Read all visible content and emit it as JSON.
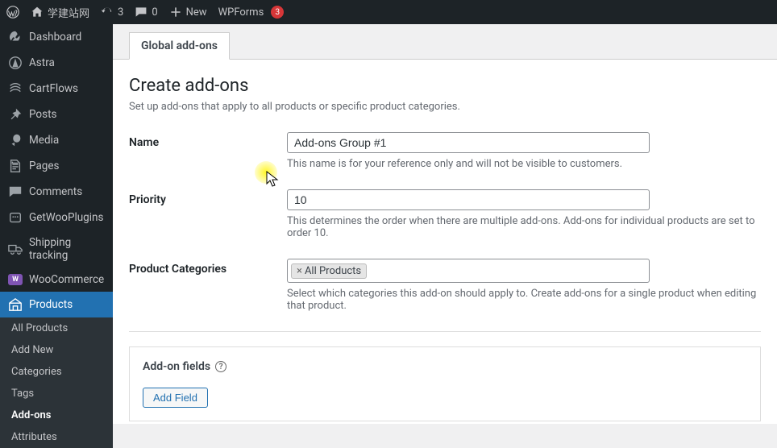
{
  "topbar": {
    "site_name": "学建站网",
    "updates_count": "3",
    "comments_count": "0",
    "new_label": "New",
    "wpforms_label": "WPForms",
    "wpforms_badge": "3"
  },
  "sidebar": {
    "items": [
      {
        "key": "dashboard",
        "label": "Dashboard"
      },
      {
        "key": "astra",
        "label": "Astra"
      },
      {
        "key": "cartflows",
        "label": "CartFlows"
      },
      {
        "key": "posts",
        "label": "Posts"
      },
      {
        "key": "media",
        "label": "Media"
      },
      {
        "key": "pages",
        "label": "Pages"
      },
      {
        "key": "comments",
        "label": "Comments"
      },
      {
        "key": "getwooplugins",
        "label": "GetWooPlugins"
      },
      {
        "key": "shipping",
        "label": "Shipping tracking"
      },
      {
        "key": "woocommerce",
        "label": "WooCommerce",
        "woo": true
      },
      {
        "key": "products",
        "label": "Products",
        "current": true
      }
    ],
    "submenu": [
      {
        "key": "all-products",
        "label": "All Products"
      },
      {
        "key": "add-new",
        "label": "Add New"
      },
      {
        "key": "categories",
        "label": "Categories"
      },
      {
        "key": "tags",
        "label": "Tags"
      },
      {
        "key": "add-ons",
        "label": "Add-ons",
        "active": true
      },
      {
        "key": "attributes",
        "label": "Attributes"
      }
    ]
  },
  "page": {
    "tab_label": "Global add-ons",
    "title": "Create add-ons",
    "subtitle": "Set up add-ons that apply to all products or specific product categories.",
    "fields": {
      "name_label": "Name",
      "name_value": "Add-ons Group #1",
      "name_desc": "This name is for your reference only and will not be visible to customers.",
      "priority_label": "Priority",
      "priority_value": "10",
      "priority_desc": "This determines the order when there are multiple add-ons. Add-ons for individual products are set to order 10.",
      "categories_label": "Product Categories",
      "categories_tag": "All Products",
      "categories_desc": "Select which categories this add-on should apply to. Create add-ons for a single product when editing that product."
    },
    "addon_panel": {
      "heading": "Add-on fields",
      "add_button": "Add Field"
    }
  }
}
